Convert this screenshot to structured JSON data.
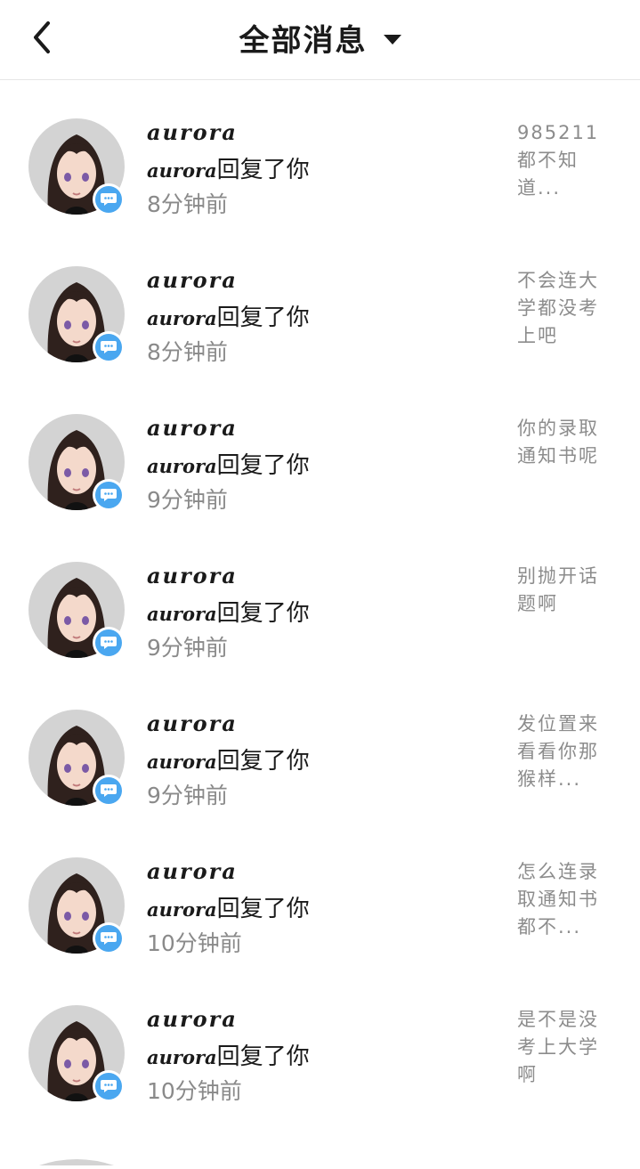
{
  "header": {
    "title": "全部消息",
    "back_icon": "chevron-left-icon",
    "dropdown_icon": "caret-down-icon"
  },
  "notifications": [
    {
      "name": "aurora",
      "actor": "aurora",
      "action": "回复了你",
      "time": "8分钟前",
      "preview": "985211都不知道..."
    },
    {
      "name": "aurora",
      "actor": "aurora",
      "action": "回复了你",
      "time": "8分钟前",
      "preview": "不会连大学都没考上吧"
    },
    {
      "name": "aurora",
      "actor": "aurora",
      "action": "回复了你",
      "time": "9分钟前",
      "preview": "你的录取通知书呢"
    },
    {
      "name": "aurora",
      "actor": "aurora",
      "action": "回复了你",
      "time": "9分钟前",
      "preview": "别抛开话题啊"
    },
    {
      "name": "aurora",
      "actor": "aurora",
      "action": "回复了你",
      "time": "9分钟前",
      "preview": "发位置来看看你那猴样..."
    },
    {
      "name": "aurora",
      "actor": "aurora",
      "action": "回复了你",
      "time": "10分钟前",
      "preview": "怎么连录取通知书都不..."
    },
    {
      "name": "aurora",
      "actor": "aurora",
      "action": "回复了你",
      "time": "10分钟前",
      "preview": "是不是没考上大学啊"
    }
  ],
  "colors": {
    "badge": "#4aa7f0",
    "secondary_text": "#8a8a8a",
    "avatar_bg": "#d3d3d3"
  }
}
